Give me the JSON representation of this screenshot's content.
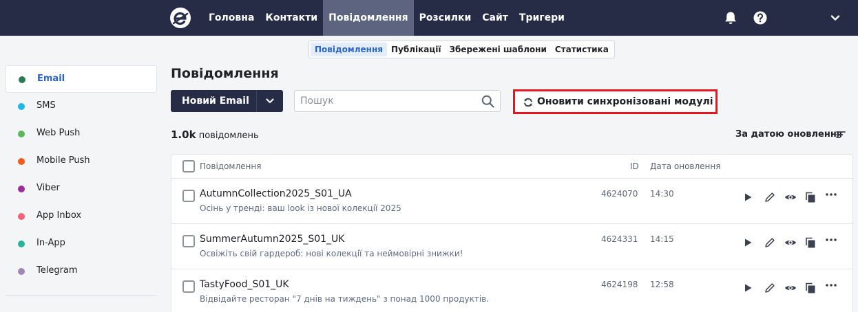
{
  "nav": {
    "items": [
      {
        "label": "Головна",
        "active": false
      },
      {
        "label": "Контакти",
        "active": false
      },
      {
        "label": "Повідомлення",
        "active": true
      },
      {
        "label": "Розсилки",
        "active": false
      },
      {
        "label": "Сайт",
        "active": false
      },
      {
        "label": "Тригери",
        "active": false
      }
    ]
  },
  "subtabs": [
    {
      "label": "Повідомлення",
      "active": true
    },
    {
      "label": "Публікації",
      "active": false
    },
    {
      "label": "Збережені шаблони",
      "active": false
    },
    {
      "label": "Статистика",
      "active": false
    }
  ],
  "sidebar": {
    "items": [
      {
        "label": "Email",
        "color": "#2a7a57",
        "active": true
      },
      {
        "label": "SMS",
        "color": "#22b5e8",
        "active": false
      },
      {
        "label": "Web Push",
        "color": "#5cb85c",
        "active": false
      },
      {
        "label": "Mobile Push",
        "color": "#f05a1c",
        "active": false
      },
      {
        "label": "Viber",
        "color": "#9b2d9f",
        "active": false
      },
      {
        "label": "App Inbox",
        "color": "#f2607e",
        "active": false
      },
      {
        "label": "In-App",
        "color": "#27b59a",
        "active": false
      },
      {
        "label": "Telegram",
        "color": "#a086b5",
        "active": false
      }
    ]
  },
  "main": {
    "title": "Повідомлення",
    "new_button": "Новий Email",
    "search_placeholder": "Пошук",
    "sync_button": "Оновити синхронізовані модулі",
    "count_value": "1.0k",
    "count_label": "повідомлень",
    "sort_label": "За датою оновлення"
  },
  "table": {
    "headers": {
      "name": "Повідомлення",
      "id": "ID",
      "date": "Дата оновлення"
    },
    "rows": [
      {
        "name": "AutumnCollection2025_S01_UA",
        "subject": "Осінь у тренді: ваш look із нової колекції 2025",
        "id": "4624070",
        "date": "14:30"
      },
      {
        "name": "SummerAutumn2025_S01_UK",
        "subject": "Освіжіть свій гардероб: нові колекції та неймовірні знижки!",
        "id": "4624331",
        "date": "14:15"
      },
      {
        "name": "TastyFood_S01_UK",
        "subject": "Відвідайте ресторан \"7 днів на тиждень\" з понад 1000 продуктів.",
        "id": "4624198",
        "date": "12:58"
      }
    ]
  },
  "colors": {
    "nav_bg": "#262c45",
    "accent": "#2d64c8",
    "highlight": "#e8141d"
  }
}
